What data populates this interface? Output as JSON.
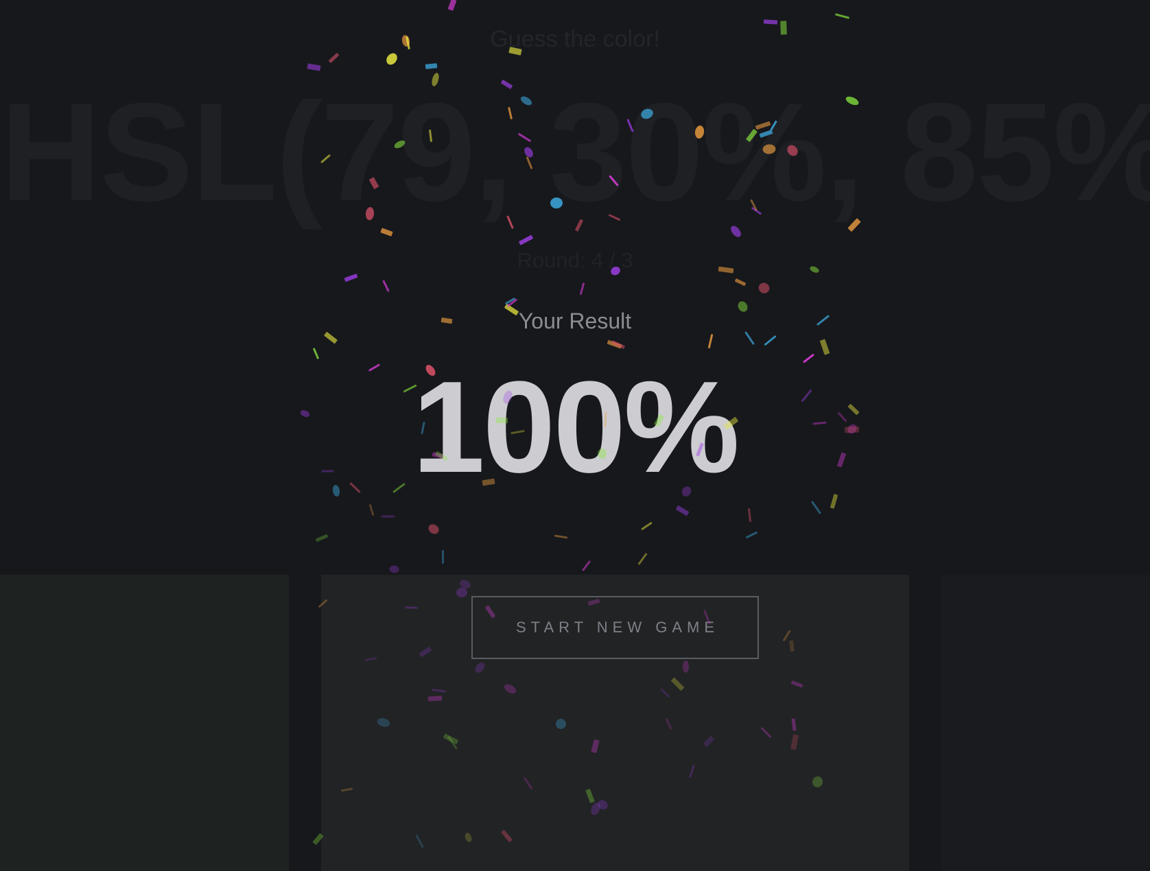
{
  "game": {
    "subtitle": "Guess the color!",
    "target_hsl": "HSL(79, 30%, 85%)",
    "round": "Round: 4 / 3"
  },
  "result": {
    "label": "Your Result",
    "score": "100%",
    "new_game_label": "START NEW GAME"
  },
  "colors": {
    "background": "#17181c",
    "score_text": "#cdcdd1",
    "confetti": [
      "#3fb0e8",
      "#e83fe8",
      "#e8e83f",
      "#e89a3f",
      "#8ae83f",
      "#a03fe8",
      "#e8556e"
    ]
  }
}
